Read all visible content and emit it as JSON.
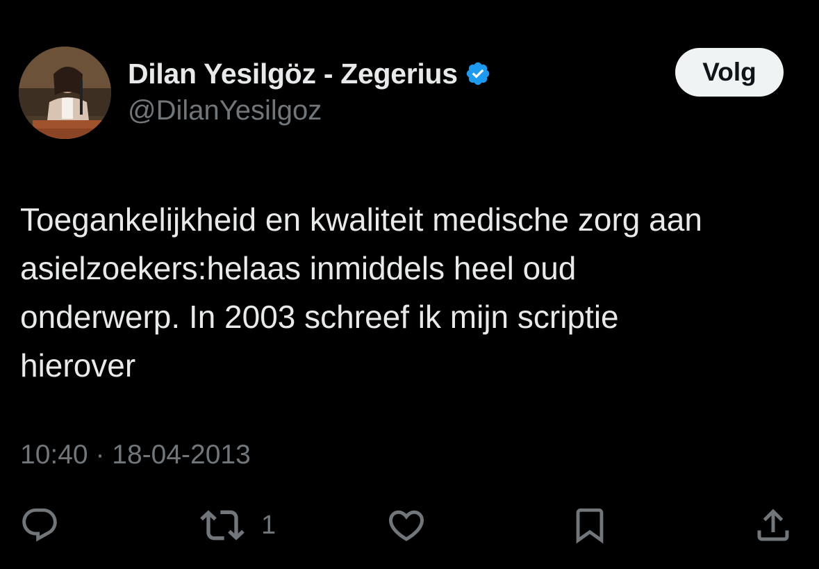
{
  "tweet": {
    "author": {
      "display_name": "Dilan Yesilgöz - Zegerius",
      "handle": "@DilanYesilgoz",
      "verified": true,
      "avatar_icon": "profile-photo-avatar"
    },
    "follow_label": "Volg",
    "text": "Toegankelijkheid en kwaliteit medische zorg aan\nasielzoekers:helaas inmiddels heel oud\nonderwerp. In 2003 schreef ik mijn scriptie\nhierover",
    "time": "10:40",
    "separator": "·",
    "date": "18-04-2013",
    "actions": {
      "reply": {
        "icon": "reply-icon",
        "count": ""
      },
      "retweet": {
        "icon": "retweet-icon",
        "count": "1"
      },
      "like": {
        "icon": "heart-icon",
        "count": ""
      },
      "bookmark": {
        "icon": "bookmark-icon",
        "count": ""
      },
      "share": {
        "icon": "share-icon",
        "count": ""
      }
    }
  },
  "colors": {
    "background": "#000000",
    "text_primary": "#e7e9ea",
    "text_secondary": "#71767b",
    "verified_badge": "#1d9bf0",
    "follow_button_bg": "#eff3f4"
  }
}
